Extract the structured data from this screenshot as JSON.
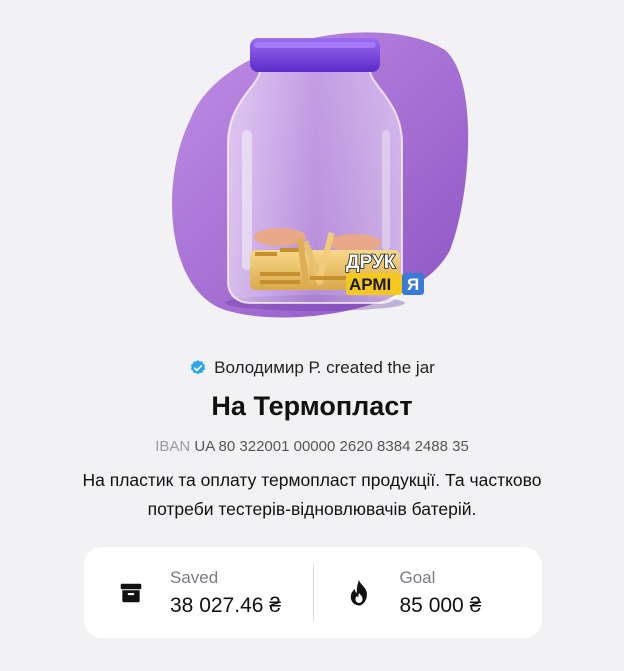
{
  "hero": {
    "badge_line1": "ДРУК",
    "badge_line2_a": "АРМІ",
    "badge_line2_b": "Я"
  },
  "creator": {
    "text": "Володимир Р. created the jar",
    "verified_icon": "verified-check-icon",
    "verified_color": "#2aa3ef"
  },
  "jar": {
    "title": "На Термопласт",
    "iban_label": "IBAN",
    "iban_value": "UA 80 322001 00000 2620 8384 2488 35",
    "description_line1": "На пластик та оплату термопласт продукції. Та частково",
    "description_line2": "потреби тестерів-відновлювачів батерій."
  },
  "stats": {
    "saved_label": "Saved",
    "saved_value": "38 027.46 ₴",
    "saved_icon": "archive-box-icon",
    "goal_label": "Goal",
    "goal_value": "85 000 ₴",
    "goal_icon": "flame-icon"
  },
  "colors": {
    "accent_purple": "#a36fd1",
    "lid_purple": "#7a3fe0",
    "background": "#f2f2f5"
  }
}
